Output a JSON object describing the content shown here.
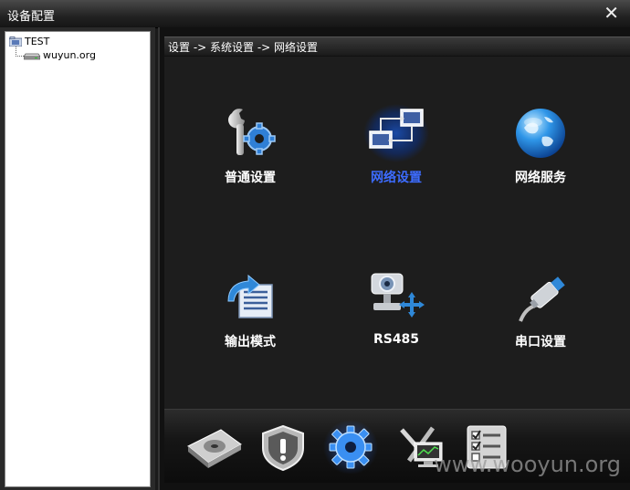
{
  "window": {
    "title": "设备配置",
    "close_glyph": "✕"
  },
  "tree": {
    "root": {
      "label": "TEST",
      "icon": "folder-icon"
    },
    "child": {
      "label": "wuyun.org",
      "icon": "dvr-device-icon"
    }
  },
  "breadcrumb": "设置 -> 系统设置 -> 网络设置",
  "menu": {
    "items": [
      {
        "label": "普通设置",
        "icon": "tools-gear-icon",
        "active": false
      },
      {
        "label": "网络设置",
        "icon": "network-computers-icon",
        "active": true
      },
      {
        "label": "网络服务",
        "icon": "globe-icon",
        "active": false
      },
      {
        "label": "输出模式",
        "icon": "output-mode-icon",
        "active": false
      },
      {
        "label": "RS485",
        "icon": "ptz-camera-icon",
        "active": false
      },
      {
        "label": "串口设置",
        "icon": "serial-cable-icon",
        "active": false
      }
    ],
    "active_color": "#3d6cff"
  },
  "dock": {
    "items": [
      "hdd-icon",
      "shield-alert-icon",
      "gear-icon",
      "tools-monitor-icon",
      "checklist-icon"
    ]
  },
  "watermark": "www.wooyun.org"
}
